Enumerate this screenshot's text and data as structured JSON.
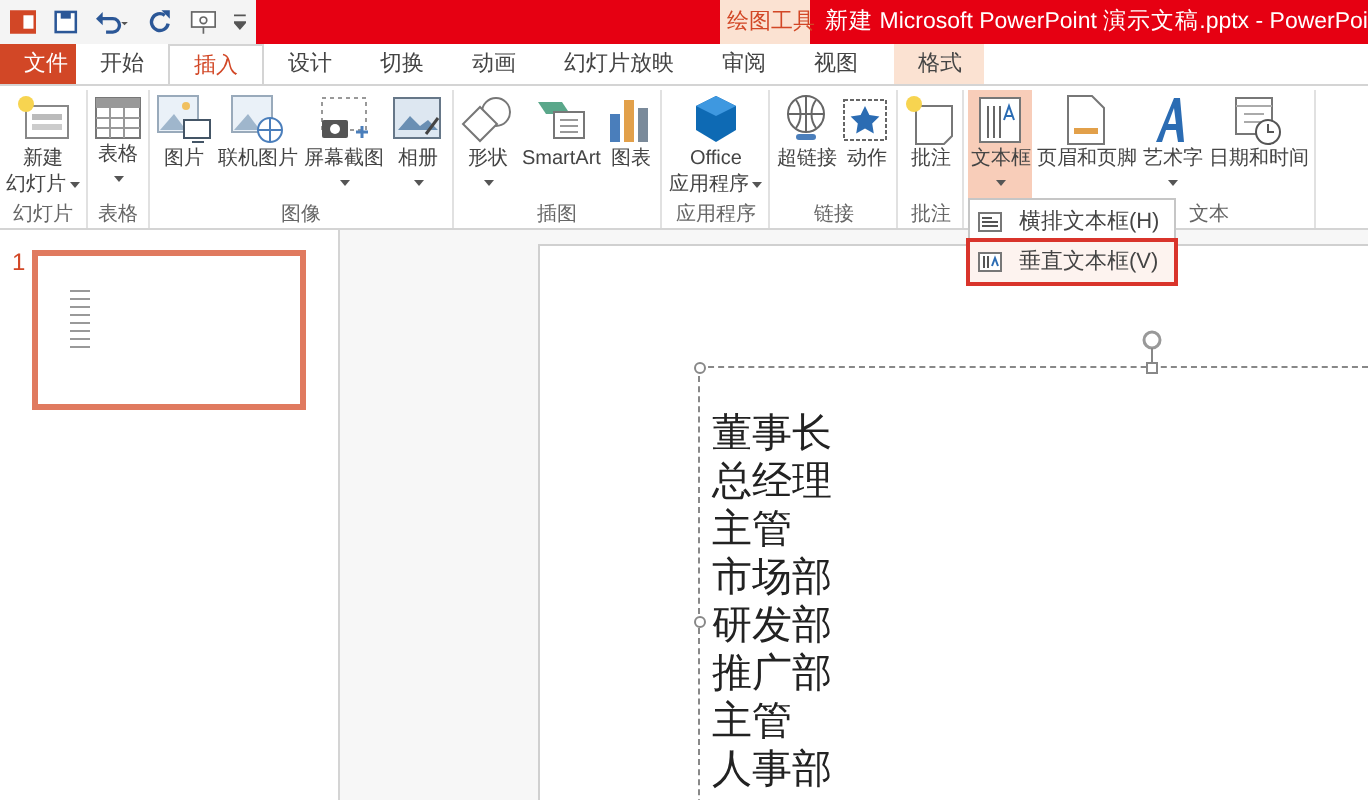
{
  "title_bar": {
    "context_tab": "绘图工具",
    "title": "新建 Microsoft PowerPoint 演示文稿.pptx - PowerPoi"
  },
  "tabs": [
    {
      "label": "文件",
      "selected": false,
      "kind": "file"
    },
    {
      "label": "开始",
      "selected": false,
      "kind": "tab"
    },
    {
      "label": "插入",
      "selected": true,
      "kind": "tab"
    },
    {
      "label": "设计",
      "selected": false,
      "kind": "tab"
    },
    {
      "label": "切换",
      "selected": false,
      "kind": "tab"
    },
    {
      "label": "动画",
      "selected": false,
      "kind": "tab"
    },
    {
      "label": "幻灯片放映",
      "selected": false,
      "kind": "tab"
    },
    {
      "label": "审阅",
      "selected": false,
      "kind": "tab"
    },
    {
      "label": "视图",
      "selected": false,
      "kind": "tab"
    },
    {
      "label": "格式",
      "selected": false,
      "kind": "context"
    }
  ],
  "ribbon": [
    {
      "label": "幻灯片",
      "buttons": [
        {
          "lines": [
            "新建",
            "幻灯片"
          ],
          "dropdown": true,
          "selected": false
        }
      ]
    },
    {
      "label": "表格",
      "buttons": [
        {
          "lines": [
            "表格"
          ],
          "dropdown": true,
          "selected": false
        }
      ]
    },
    {
      "label": "图像",
      "buttons": [
        {
          "lines": [
            "图片"
          ],
          "dropdown": false,
          "selected": false
        },
        {
          "lines": [
            "联机图片"
          ],
          "dropdown": false,
          "selected": false
        },
        {
          "lines": [
            "屏幕截图"
          ],
          "dropdown": true,
          "selected": false
        },
        {
          "lines": [
            "相册"
          ],
          "dropdown": true,
          "selected": false
        }
      ]
    },
    {
      "label": "插图",
      "buttons": [
        {
          "lines": [
            "形状"
          ],
          "dropdown": true,
          "selected": false
        },
        {
          "lines": [
            "SmartArt"
          ],
          "dropdown": false,
          "selected": false
        },
        {
          "lines": [
            "图表"
          ],
          "dropdown": false,
          "selected": false
        }
      ]
    },
    {
      "label": "应用程序",
      "buttons": [
        {
          "lines": [
            "Office",
            "应用程序"
          ],
          "dropdown": true,
          "selected": false
        }
      ]
    },
    {
      "label": "链接",
      "buttons": [
        {
          "lines": [
            "超链接"
          ],
          "dropdown": false,
          "selected": false
        },
        {
          "lines": [
            "动作"
          ],
          "dropdown": false,
          "selected": false
        }
      ]
    },
    {
      "label": "批注",
      "buttons": [
        {
          "lines": [
            "批注"
          ],
          "dropdown": false,
          "selected": false
        }
      ]
    },
    {
      "label": "文本",
      "buttons": [
        {
          "lines": [
            "文本框"
          ],
          "dropdown": true,
          "selected": true
        },
        {
          "lines": [
            "页眉和页脚"
          ],
          "dropdown": false,
          "selected": false
        },
        {
          "lines": [
            "艺术字"
          ],
          "dropdown": true,
          "selected": false
        },
        {
          "lines": [
            "日期和时间"
          ],
          "dropdown": false,
          "selected": false
        }
      ]
    }
  ],
  "textbox_menu": [
    {
      "label": "横排文本框(H)",
      "highlighted": false
    },
    {
      "label": "垂直文本框(V)",
      "highlighted": true
    }
  ],
  "slides": [
    {
      "number": "1",
      "selected": true
    }
  ],
  "slide_text": [
    "董事长",
    "总经理",
    "主管",
    "市场部",
    "研发部",
    "推广部",
    "主管",
    "人事部"
  ]
}
